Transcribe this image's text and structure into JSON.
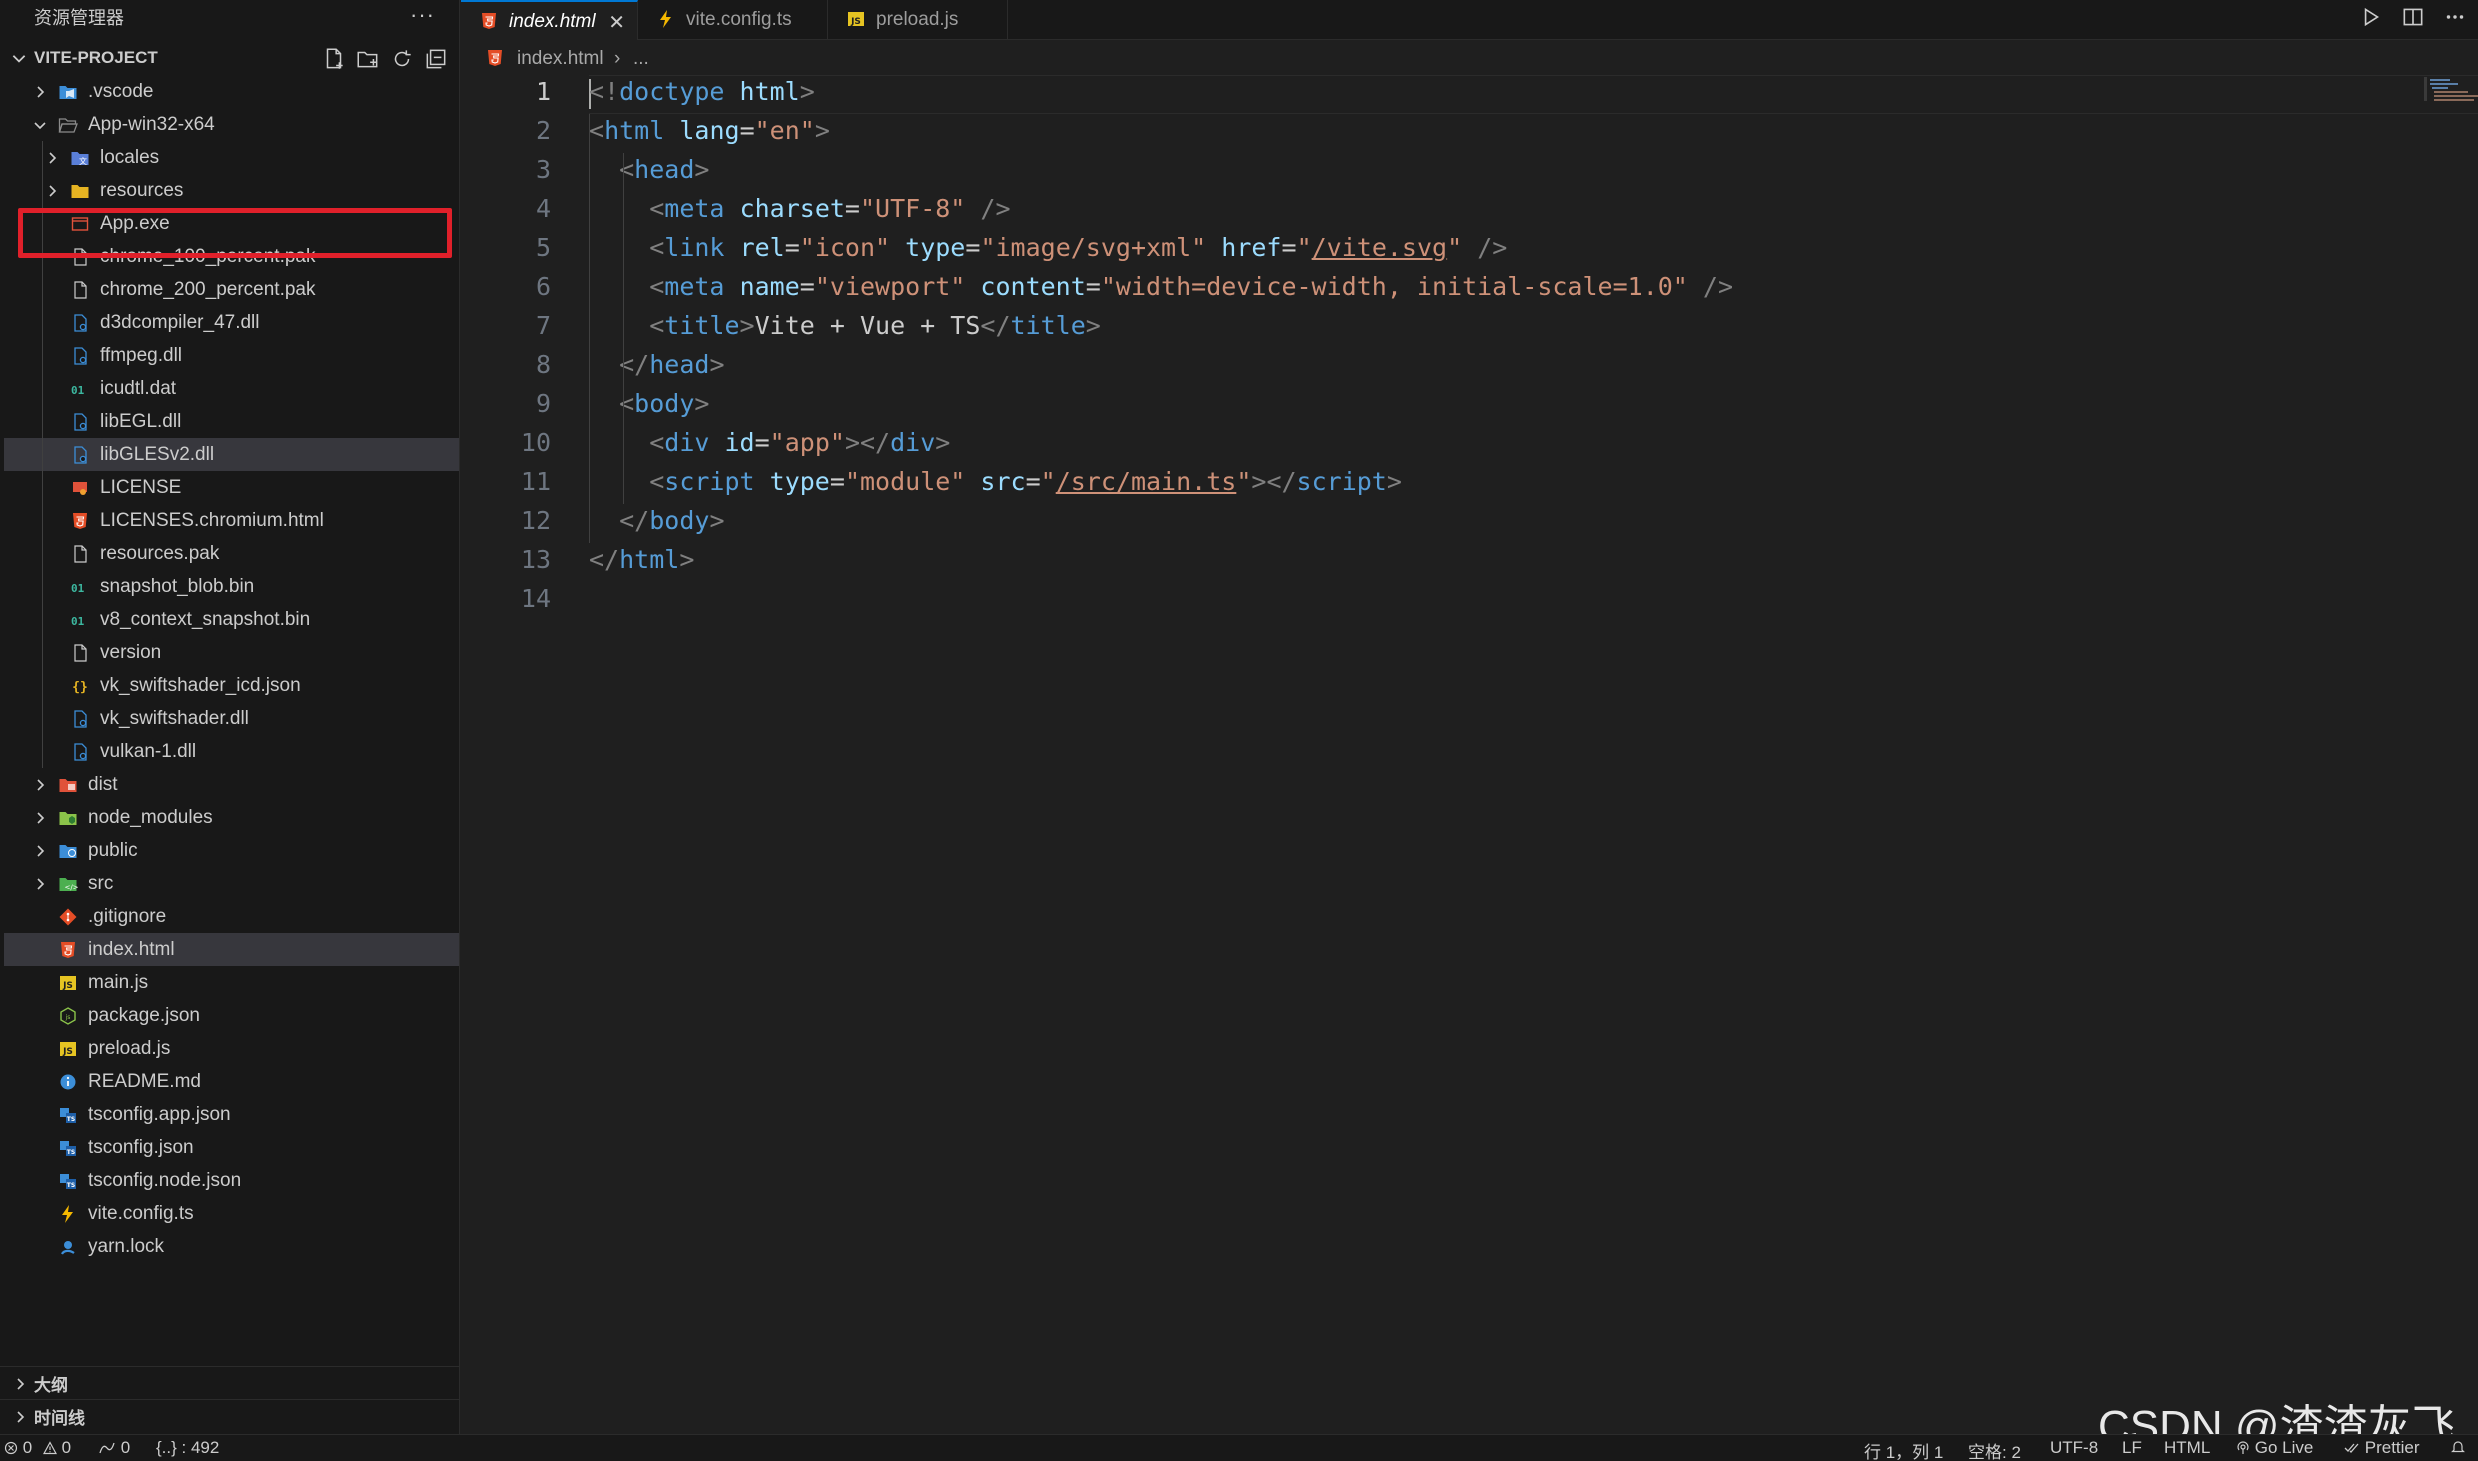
{
  "sidebar": {
    "title": "资源管理器",
    "more": "···",
    "project": "VITE-PROJECT",
    "tree": [
      {
        "label": ".vscode",
        "depth": 1,
        "twist": "right",
        "icon": "folder-vscode",
        "color": "#3c8ed8"
      },
      {
        "label": "App-win32-x64",
        "depth": 1,
        "twist": "down",
        "icon": "folder-open",
        "color": "#8a8a8a"
      },
      {
        "label": "locales",
        "depth": 2,
        "twist": "right",
        "icon": "folder-locales",
        "color": "#5a7fd8"
      },
      {
        "label": "resources",
        "depth": 2,
        "twist": "right",
        "icon": "folder-resources",
        "color": "#e6b422"
      },
      {
        "label": "App.exe",
        "depth": 2,
        "twist": "none",
        "icon": "exe-file",
        "color": "#e0523a"
      },
      {
        "label": "chrome_100_percent.pak",
        "depth": 2,
        "twist": "none",
        "icon": "file",
        "color": "#cccccc"
      },
      {
        "label": "chrome_200_percent.pak",
        "depth": 2,
        "twist": "none",
        "icon": "file",
        "color": "#cccccc"
      },
      {
        "label": "d3dcompiler_47.dll",
        "depth": 2,
        "twist": "none",
        "icon": "dll-file",
        "color": "#3c8ed8"
      },
      {
        "label": "ffmpeg.dll",
        "depth": 2,
        "twist": "none",
        "icon": "dll-file",
        "color": "#3c8ed8"
      },
      {
        "label": "icudtl.dat",
        "depth": 2,
        "twist": "none",
        "icon": "binary-file",
        "color": "#3cb8a0"
      },
      {
        "label": "libEGL.dll",
        "depth": 2,
        "twist": "none",
        "icon": "dll-file",
        "color": "#3c8ed8"
      },
      {
        "label": "libGLESv2.dll",
        "depth": 2,
        "twist": "none",
        "icon": "dll-file",
        "color": "#3c8ed8",
        "hover": true
      },
      {
        "label": "LICENSE",
        "depth": 2,
        "twist": "none",
        "icon": "license-file",
        "color": "#e0523a"
      },
      {
        "label": "LICENSES.chromium.html",
        "depth": 2,
        "twist": "none",
        "icon": "html-file",
        "color": "#e44d26"
      },
      {
        "label": "resources.pak",
        "depth": 2,
        "twist": "none",
        "icon": "file",
        "color": "#cccccc"
      },
      {
        "label": "snapshot_blob.bin",
        "depth": 2,
        "twist": "none",
        "icon": "binary-file",
        "color": "#3cb8a0"
      },
      {
        "label": "v8_context_snapshot.bin",
        "depth": 2,
        "twist": "none",
        "icon": "binary-file",
        "color": "#3cb8a0"
      },
      {
        "label": "version",
        "depth": 2,
        "twist": "none",
        "icon": "file",
        "color": "#cccccc"
      },
      {
        "label": "vk_swiftshader_icd.json",
        "depth": 2,
        "twist": "none",
        "icon": "json-file",
        "color": "#e6b422"
      },
      {
        "label": "vk_swiftshader.dll",
        "depth": 2,
        "twist": "none",
        "icon": "dll-file",
        "color": "#3c8ed8"
      },
      {
        "label": "vulkan-1.dll",
        "depth": 2,
        "twist": "none",
        "icon": "dll-file",
        "color": "#3c8ed8"
      },
      {
        "label": "dist",
        "depth": 1,
        "twist": "right",
        "icon": "folder-dist",
        "color": "#e0523a"
      },
      {
        "label": "node_modules",
        "depth": 1,
        "twist": "right",
        "icon": "folder-node",
        "color": "#8bc34a"
      },
      {
        "label": "public",
        "depth": 1,
        "twist": "right",
        "icon": "folder-public",
        "color": "#3c8ed8"
      },
      {
        "label": "src",
        "depth": 1,
        "twist": "right",
        "icon": "folder-src",
        "color": "#4caf50"
      },
      {
        "label": ".gitignore",
        "depth": 1,
        "twist": "none",
        "icon": "git-file",
        "color": "#e44d26"
      },
      {
        "label": "index.html",
        "depth": 1,
        "twist": "none",
        "icon": "html-file",
        "color": "#e44d26",
        "selected": true
      },
      {
        "label": "main.js",
        "depth": 1,
        "twist": "none",
        "icon": "js-file",
        "color": "#e6c422"
      },
      {
        "label": "package.json",
        "depth": 1,
        "twist": "none",
        "icon": "nodejs-file",
        "color": "#8bc34a"
      },
      {
        "label": "preload.js",
        "depth": 1,
        "twist": "none",
        "icon": "js-file",
        "color": "#e6c422"
      },
      {
        "label": "README.md",
        "depth": 1,
        "twist": "none",
        "icon": "info-file",
        "color": "#3c8ed8"
      },
      {
        "label": "tsconfig.app.json",
        "depth": 1,
        "twist": "none",
        "icon": "tsconfig-file",
        "color": "#3c8ed8"
      },
      {
        "label": "tsconfig.json",
        "depth": 1,
        "twist": "none",
        "icon": "tsconfig-file",
        "color": "#3c8ed8"
      },
      {
        "label": "tsconfig.node.json",
        "depth": 1,
        "twist": "none",
        "icon": "tsconfig-file",
        "color": "#3c8ed8"
      },
      {
        "label": "vite.config.ts",
        "depth": 1,
        "twist": "none",
        "icon": "vite-file",
        "color": "#f5b800"
      },
      {
        "label": "yarn.lock",
        "depth": 1,
        "twist": "none",
        "icon": "yarn-file",
        "color": "#3c8ed8"
      }
    ],
    "outline": "大纲",
    "timeline": "时间线"
  },
  "tabs": [
    {
      "label": "index.html",
      "icon": "html-file",
      "active": true,
      "close": "✕"
    },
    {
      "label": "vite.config.ts",
      "icon": "vite-file",
      "active": false
    },
    {
      "label": "preload.js",
      "icon": "js-file",
      "active": false
    }
  ],
  "breadcrumb": {
    "file": "index.html",
    "sep": "›",
    "rest": "..."
  },
  "editor": {
    "line_numbers": [
      "1",
      "2",
      "3",
      "4",
      "5",
      "6",
      "7",
      "8",
      "9",
      "10",
      "11",
      "12",
      "13",
      "14"
    ],
    "lines": [
      [
        [
          "br",
          "<!"
        ],
        [
          "tag",
          "doctype"
        ],
        [
          "txt",
          " "
        ],
        [
          "att",
          "html"
        ],
        [
          "br",
          ">"
        ]
      ],
      [
        [
          "br",
          "<"
        ],
        [
          "tag",
          "html"
        ],
        [
          "txt",
          " "
        ],
        [
          "att",
          "lang"
        ],
        [
          "txt",
          "="
        ],
        [
          "str",
          "\"en\""
        ],
        [
          "br",
          ">"
        ]
      ],
      [
        [
          "txt",
          "  "
        ],
        [
          "br",
          "<"
        ],
        [
          "tag",
          "head"
        ],
        [
          "br",
          ">"
        ]
      ],
      [
        [
          "txt",
          "    "
        ],
        [
          "br",
          "<"
        ],
        [
          "tag",
          "meta"
        ],
        [
          "txt",
          " "
        ],
        [
          "att",
          "charset"
        ],
        [
          "txt",
          "="
        ],
        [
          "str",
          "\"UTF-8\""
        ],
        [
          "txt",
          " "
        ],
        [
          "br",
          "/>"
        ]
      ],
      [
        [
          "txt",
          "    "
        ],
        [
          "br",
          "<"
        ],
        [
          "tag",
          "link"
        ],
        [
          "txt",
          " "
        ],
        [
          "att",
          "rel"
        ],
        [
          "txt",
          "="
        ],
        [
          "str",
          "\"icon\""
        ],
        [
          "txt",
          " "
        ],
        [
          "att",
          "type"
        ],
        [
          "txt",
          "="
        ],
        [
          "str",
          "\"image/svg+xml\""
        ],
        [
          "txt",
          " "
        ],
        [
          "att",
          "href"
        ],
        [
          "txt",
          "="
        ],
        [
          "str",
          "\""
        ],
        [
          "link",
          "/vite.svg"
        ],
        [
          "str",
          "\""
        ],
        [
          "txt",
          " "
        ],
        [
          "br",
          "/>"
        ]
      ],
      [
        [
          "txt",
          "    "
        ],
        [
          "br",
          "<"
        ],
        [
          "tag",
          "meta"
        ],
        [
          "txt",
          " "
        ],
        [
          "att",
          "name"
        ],
        [
          "txt",
          "="
        ],
        [
          "str",
          "\"viewport\""
        ],
        [
          "txt",
          " "
        ],
        [
          "att",
          "content"
        ],
        [
          "txt",
          "="
        ],
        [
          "str",
          "\"width=device-width, initial-scale=1.0\""
        ],
        [
          "txt",
          " "
        ],
        [
          "br",
          "/>"
        ]
      ],
      [
        [
          "txt",
          "    "
        ],
        [
          "br",
          "<"
        ],
        [
          "tag",
          "title"
        ],
        [
          "br",
          ">"
        ],
        [
          "txt",
          "Vite + Vue + TS"
        ],
        [
          "br",
          "</"
        ],
        [
          "tag",
          "title"
        ],
        [
          "br",
          ">"
        ]
      ],
      [
        [
          "txt",
          "  "
        ],
        [
          "br",
          "</"
        ],
        [
          "tag",
          "head"
        ],
        [
          "br",
          ">"
        ]
      ],
      [
        [
          "txt",
          "  "
        ],
        [
          "br",
          "<"
        ],
        [
          "tag",
          "body"
        ],
        [
          "br",
          ">"
        ]
      ],
      [
        [
          "txt",
          "    "
        ],
        [
          "br",
          "<"
        ],
        [
          "tag",
          "div"
        ],
        [
          "txt",
          " "
        ],
        [
          "att",
          "id"
        ],
        [
          "txt",
          "="
        ],
        [
          "str",
          "\"app\""
        ],
        [
          "br",
          "></"
        ],
        [
          "tag",
          "div"
        ],
        [
          "br",
          ">"
        ]
      ],
      [
        [
          "txt",
          "    "
        ],
        [
          "br",
          "<"
        ],
        [
          "tag",
          "script"
        ],
        [
          "txt",
          " "
        ],
        [
          "att",
          "type"
        ],
        [
          "txt",
          "="
        ],
        [
          "str",
          "\"module\""
        ],
        [
          "txt",
          " "
        ],
        [
          "att",
          "src"
        ],
        [
          "txt",
          "="
        ],
        [
          "str",
          "\""
        ],
        [
          "link",
          "/src/main.ts"
        ],
        [
          "str",
          "\""
        ],
        [
          "br",
          "></"
        ],
        [
          "tag",
          "script"
        ],
        [
          "br",
          ">"
        ]
      ],
      [
        [
          "txt",
          "  "
        ],
        [
          "br",
          "</"
        ],
        [
          "tag",
          "body"
        ],
        [
          "br",
          ">"
        ]
      ],
      [
        [
          "br",
          "</"
        ],
        [
          "tag",
          "html"
        ],
        [
          "br",
          ">"
        ]
      ],
      []
    ]
  },
  "watermark": "CSDN @渣渣灰飞",
  "statusbar": {
    "errors": "0",
    "warnings": "0",
    "ports": "0",
    "json_count": "{..} : 492",
    "position": "行 1，列 1",
    "spaces": "空格: 2",
    "encoding": "UTF-8",
    "eol": "LF",
    "language": "HTML",
    "golive": "Go Live",
    "prettier": "Prettier"
  },
  "colors": {
    "accent": "#0078d4",
    "highlight_box": "#e0202a"
  }
}
